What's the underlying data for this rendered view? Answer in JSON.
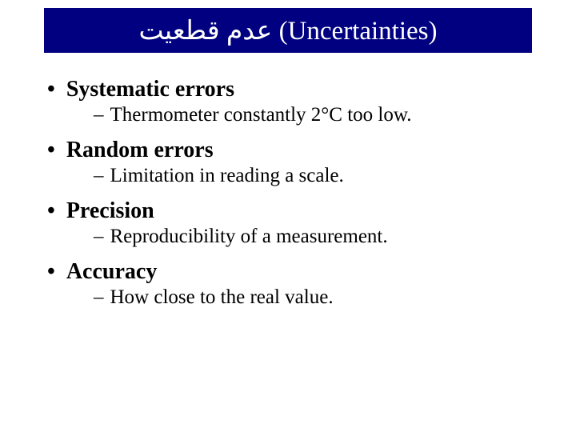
{
  "title": "عدم قطعیت (Uncertainties)",
  "items": [
    {
      "heading": "Systematic errors",
      "sub": "Thermometer constantly 2°C too low."
    },
    {
      "heading": "Random errors",
      "sub": "Limitation in reading a scale."
    },
    {
      "heading": "Precision",
      "sub": "Reproducibility of a measurement."
    },
    {
      "heading": "Accuracy",
      "sub": "How close to the real value."
    }
  ]
}
